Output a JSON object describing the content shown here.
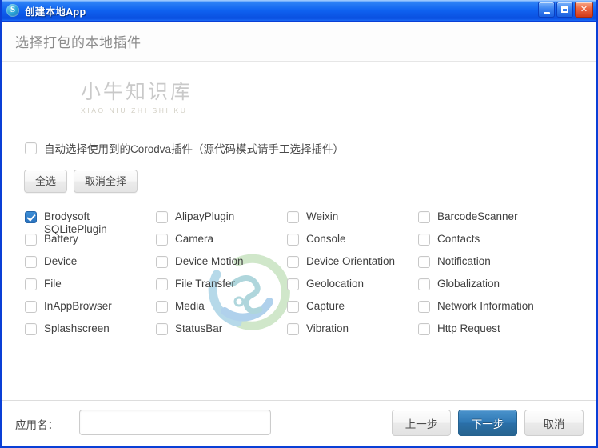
{
  "window": {
    "title": "创建本地App",
    "icon": "app-logo-icon",
    "controls": {
      "minimize": "minimize-icon",
      "maximize": "maximize-icon",
      "close": "close-icon"
    }
  },
  "header": {
    "title": "选择打包的本地插件"
  },
  "auto_select": {
    "label": "自动选择使用到的Corodva插件（源代码模式请手工选择插件）",
    "checked": false
  },
  "actions": {
    "select_all": "全选",
    "deselect_all": "取消全择"
  },
  "watermark": {
    "cn": "小牛知识库",
    "en": "XIAO NIU ZHI SHI KU"
  },
  "plugins": [
    {
      "label": "Brodysoft\nSQLitePlugin",
      "checked": true,
      "col": 0,
      "row": 0
    },
    {
      "label": "Battery",
      "checked": false,
      "col": 0,
      "row": 1
    },
    {
      "label": "Device",
      "checked": false,
      "col": 0,
      "row": 2
    },
    {
      "label": "File",
      "checked": false,
      "col": 0,
      "row": 3
    },
    {
      "label": "InAppBrowser",
      "checked": false,
      "col": 0,
      "row": 4
    },
    {
      "label": "Splashscreen",
      "checked": false,
      "col": 0,
      "row": 5
    },
    {
      "label": "AlipayPlugin",
      "checked": false,
      "col": 1,
      "row": 0
    },
    {
      "label": "Camera",
      "checked": false,
      "col": 1,
      "row": 1
    },
    {
      "label": "Device Motion",
      "checked": false,
      "col": 1,
      "row": 2
    },
    {
      "label": "File Transfer",
      "checked": false,
      "col": 1,
      "row": 3
    },
    {
      "label": "Media",
      "checked": false,
      "col": 1,
      "row": 4
    },
    {
      "label": "StatusBar",
      "checked": false,
      "col": 1,
      "row": 5
    },
    {
      "label": "Weixin",
      "checked": false,
      "col": 2,
      "row": 0
    },
    {
      "label": "Console",
      "checked": false,
      "col": 2,
      "row": 1
    },
    {
      "label": "Device Orientation",
      "checked": false,
      "col": 2,
      "row": 2
    },
    {
      "label": "Geolocation",
      "checked": false,
      "col": 2,
      "row": 3
    },
    {
      "label": "Capture",
      "checked": false,
      "col": 2,
      "row": 4
    },
    {
      "label": "Vibration",
      "checked": false,
      "col": 2,
      "row": 5
    },
    {
      "label": "BarcodeScanner",
      "checked": false,
      "col": 3,
      "row": 0
    },
    {
      "label": "Contacts",
      "checked": false,
      "col": 3,
      "row": 1
    },
    {
      "label": "Notification",
      "checked": false,
      "col": 3,
      "row": 2
    },
    {
      "label": "Globalization",
      "checked": false,
      "col": 3,
      "row": 3
    },
    {
      "label": "Network Information",
      "checked": false,
      "col": 3,
      "row": 4
    },
    {
      "label": "Http Request",
      "checked": false,
      "col": 3,
      "row": 5
    }
  ],
  "footer": {
    "app_name_label": "应用名：",
    "app_name_value": "",
    "app_name_placeholder": "",
    "prev": "上一步",
    "next": "下一步",
    "cancel": "取消"
  },
  "colors": {
    "titlebar_blue": "#0f62f0",
    "frame_blue": "#0a3fd6",
    "primary_button": "#2f78b4",
    "checkbox_checked": "#2a72be",
    "header_text": "#8b8b8b"
  }
}
